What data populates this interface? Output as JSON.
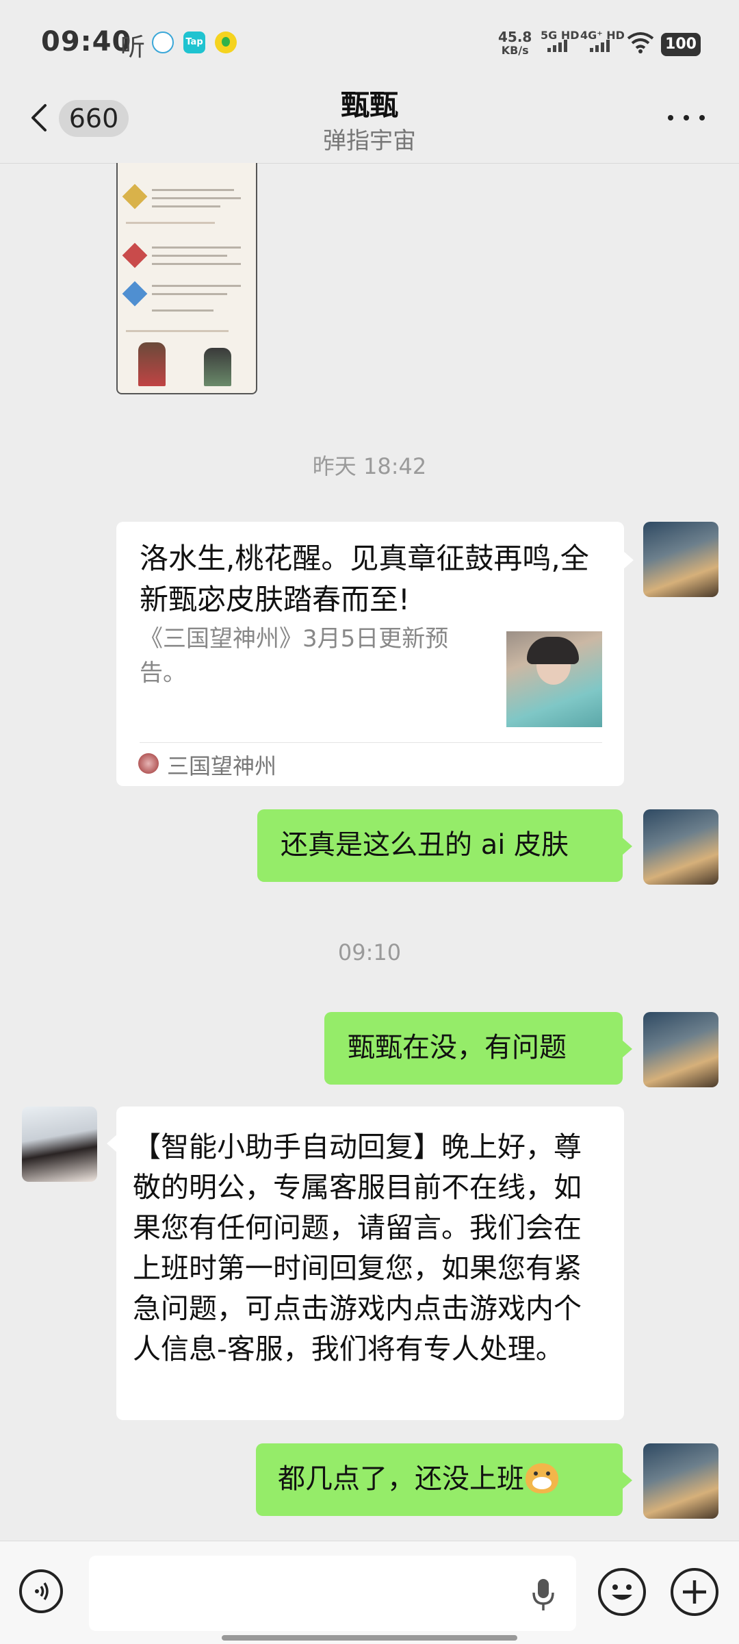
{
  "status_bar": {
    "time": "09:40",
    "listen": "听",
    "app_icons": [
      "chat-bubble-icon",
      "taptap-icon",
      "qq-music-icon"
    ],
    "tap_label": "Tap",
    "net_speed": "45.8",
    "net_unit": "KB/s",
    "sim1": "5G HD",
    "sim2": "4G⁺ HD",
    "battery": "100"
  },
  "header": {
    "unread_count": "660",
    "title": "甄甄",
    "subtitle": "弹指宇宙"
  },
  "messages": {
    "time1": "昨天 18:42",
    "card": {
      "title": "洛水生,桃花醒。见真章征鼓再鸣,全新甄宓皮肤踏春而至!",
      "desc": "《三国望神州》3月5日更新预告。",
      "source": "三国望神州"
    },
    "msg1": "还真是这么丑的 ai 皮肤",
    "time2": "09:10",
    "msg2": "甄甄在没，有问题",
    "reply": "【智能小助手自动回复】晚上好，尊敬的明公，专属客服目前不在线，如果您有任何问题，请留言。我们会在上班时第一时间回复您，如果您有紧急问题，可点击游戏内点击游戏内个人信息-客服，我们将有专人处理。",
    "msg3": "都几点了，还没上班"
  },
  "colors": {
    "sent_bubble": "#95ec69",
    "received_bubble": "#ffffff",
    "background": "#ededed"
  }
}
